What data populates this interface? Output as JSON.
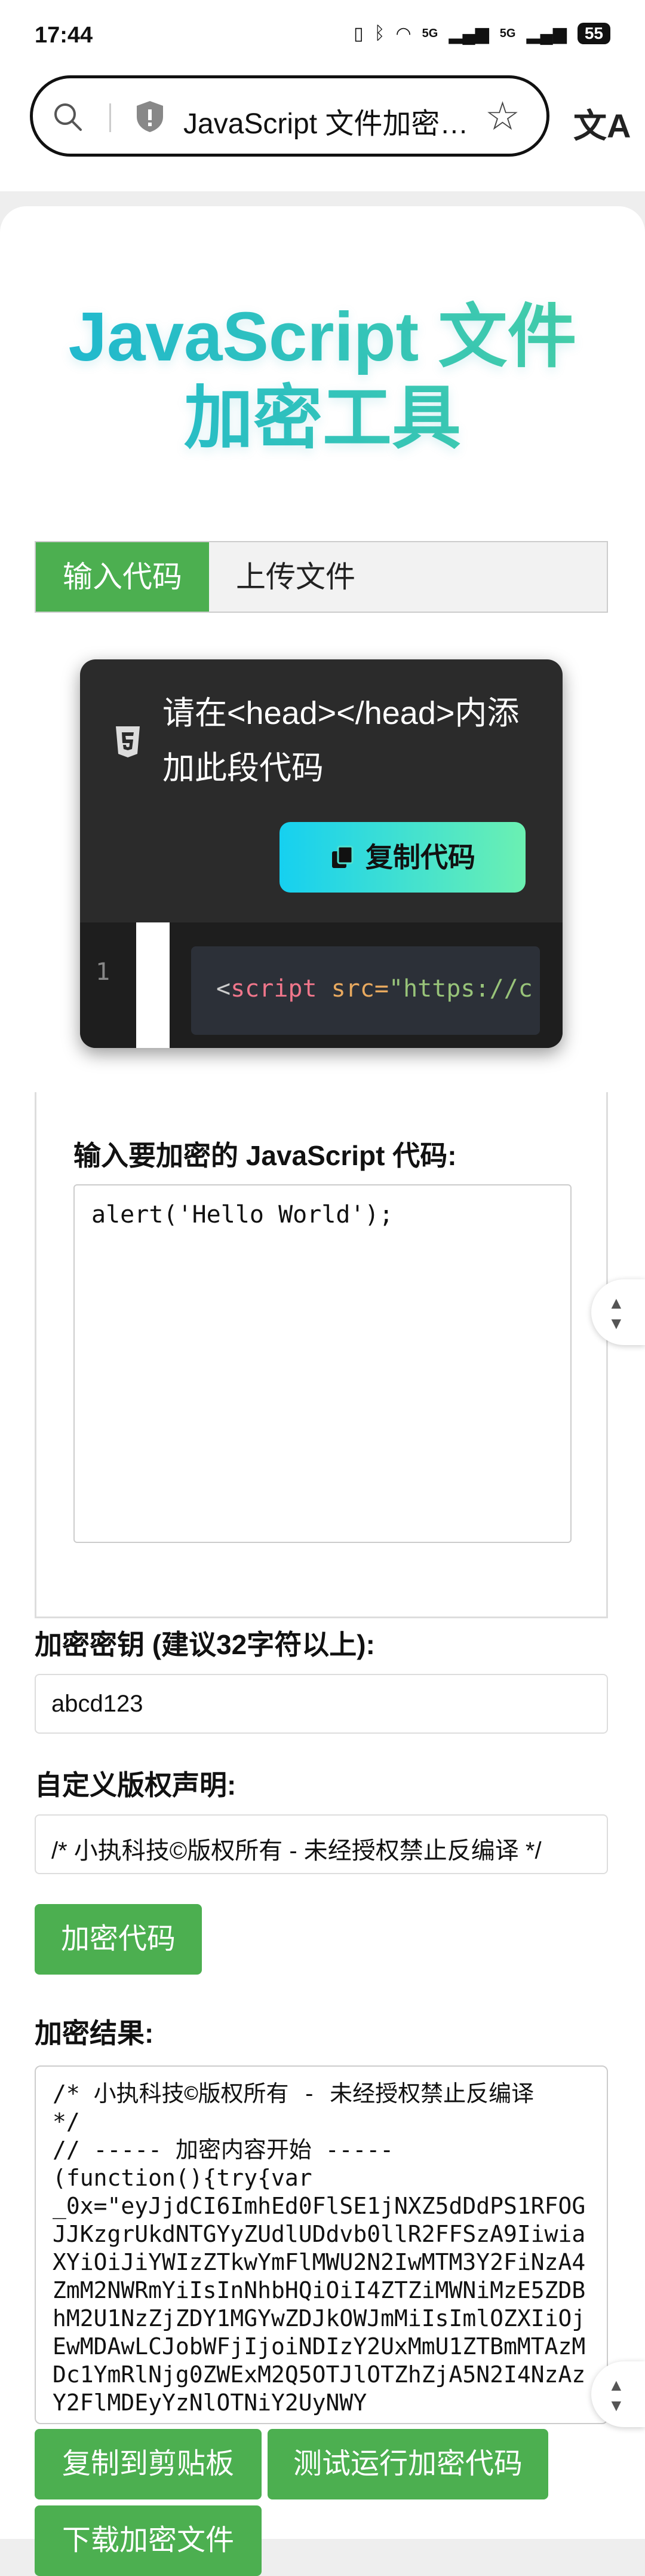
{
  "status": {
    "time": "17:44",
    "signal_labels": [
      "5G",
      "5G"
    ],
    "battery": "55"
  },
  "browser": {
    "url_text": "JavaScript 文件加密…",
    "translate_label": "文A"
  },
  "page": {
    "title_line1": "JavaScript 文件",
    "title_line2": "加密工具",
    "tabs": [
      {
        "label": "输入代码"
      },
      {
        "label": "上传文件"
      }
    ],
    "snippet": {
      "message": "请在<head></head>内添加此段代码",
      "copy_button": "复制代码",
      "line_number": "1",
      "code_punct": "<",
      "code_tag": "script",
      "code_attr": " src=",
      "code_str": "\"https://c"
    },
    "code_label": "输入要加密的 JavaScript 代码:",
    "code_value": "alert('Hello World');",
    "key_label": "加密密钥 (建议32字符以上):",
    "key_value": "abcd123",
    "copyright_label": "自定义版权声明:",
    "copyright_value": "/* 小执科技©版权所有 - 未经授权禁止反编译 */",
    "encrypt_button": "加密代码",
    "result_label": "加密结果:",
    "result_text": "/* 小执科技©版权所有 - 未经授权禁止反编译\n*/\n// ----- 加密内容开始 -----\n(function(){try{var\n_0x=\"eyJjdCI6ImhEd0FlSE1jNXZ5dDdPS1RFOGJJKzgrUkdNTGYyZUdlUDdvb0llR2FFSzA9IiwiaXYiOiJiYWIzZTkwYmFlMWU2N2IwMTM3Y2FiNzA4ZmM2NWRmYiIsInNhbHQiOiI4ZTZiMWNiMzE5ZDBhM2U1NzZjZDY1MGYwZDJkOWJmMiIsImlOZXIiOjEwMDAwLCJobWFjIjoiNDIzY2UxMmU1ZTBmMTAzMDc1YmRlNjg0ZWExM2Q5OTJlOTZhZjA5N2I4NzAzY2FlMDEyYzNlOTNiY2UyNWY",
    "copy_clipboard_button": "复制到剪贴板",
    "test_run_button": "测试运行加密代码",
    "download_button": "下载加密文件"
  },
  "colors": {
    "primary": "#4caf50",
    "title_gradient_start": "#1fb9d6",
    "title_gradient_end": "#4ed3a3"
  },
  "icons": [
    "search-icon",
    "shield-icon",
    "star-icon",
    "translate-icon",
    "html5-icon",
    "copy-icon",
    "scroll-updown-icon"
  ]
}
